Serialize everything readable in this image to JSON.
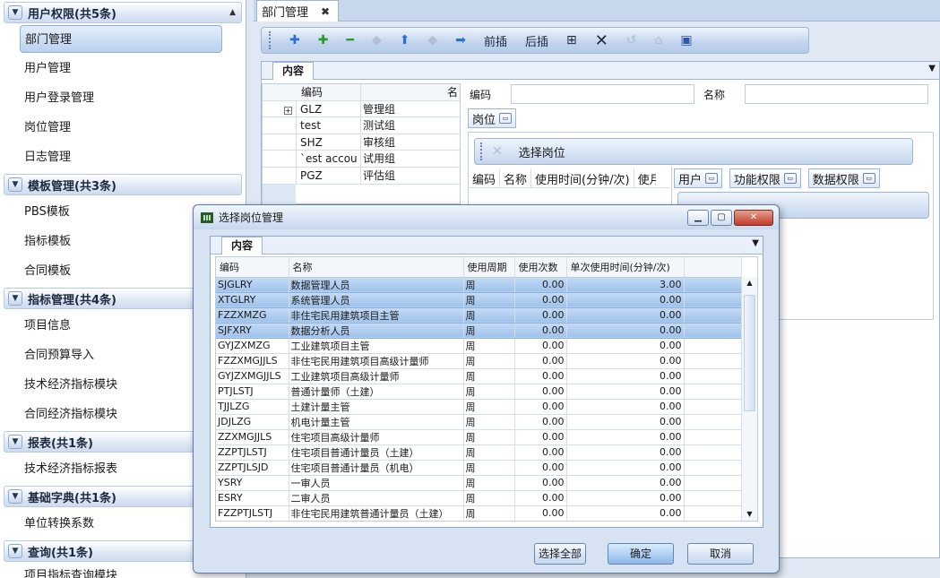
{
  "nav": {
    "groups": [
      {
        "title": "用户权限(共5条)",
        "items": [
          "部门管理",
          "用户管理",
          "用户登录管理",
          "岗位管理",
          "日志管理"
        ]
      },
      {
        "title": "模板管理(共3条)",
        "items": [
          "PBS模板",
          "指标模板",
          "合同模板"
        ]
      },
      {
        "title": "指标管理(共4条)",
        "items": [
          "项目信息",
          "合同预算导入",
          "技术经济指标模块",
          "合同经济指标模块"
        ]
      },
      {
        "title": "报表(共1条)",
        "items": [
          "技术经济指标报表"
        ]
      },
      {
        "title": "基础字典(共1条)",
        "items": [
          "单位转换系数"
        ]
      },
      {
        "title": "查询(共1条)",
        "items": [
          "项目指标查询模块"
        ]
      }
    ],
    "selected": "部门管理"
  },
  "main": {
    "tab_label": "部门管理",
    "toolbar": {
      "insert_before": "前插",
      "insert_after": "后插"
    },
    "content_tab": "内容",
    "dept_grid": {
      "headers": [
        "编码",
        "名"
      ],
      "rows": [
        {
          "code": "GLZ",
          "name": "管理组"
        },
        {
          "code": "test",
          "name": "测试组"
        },
        {
          "code": "SHZ",
          "name": "审核组"
        },
        {
          "code": "`est accou",
          "name": "试用组"
        },
        {
          "code": "PGZ",
          "name": "评估组"
        }
      ]
    },
    "form": {
      "code_label": "编码",
      "name_label": "名称"
    },
    "post_tab": "岗位",
    "select_post_btn": "选择岗位",
    "post_grid_headers": [
      "编码",
      "名称",
      "使用时间(分钟/次)",
      "使月"
    ],
    "sub_tabs": [
      "用户",
      "功能权限",
      "数据权限"
    ]
  },
  "dialog": {
    "title": "选择岗位管理",
    "content_tab": "内容",
    "headers": [
      "编码",
      "名称",
      "使用周期",
      "使用次数",
      "单次使用时间(分钟/次)"
    ],
    "rows": [
      {
        "code": "SJGLRY",
        "name": "数据管理人员",
        "period": "周",
        "count": "0.00",
        "time": "3.00",
        "sel": true
      },
      {
        "code": "XTGLRY",
        "name": "系统管理人员",
        "period": "周",
        "count": "0.00",
        "time": "0.00",
        "sel": true
      },
      {
        "code": "FZZXMZG",
        "name": "非住宅民用建筑项目主管",
        "period": "周",
        "count": "0.00",
        "time": "0.00",
        "sel": true
      },
      {
        "code": "SJFXRY",
        "name": "数据分析人员",
        "period": "周",
        "count": "0.00",
        "time": "0.00",
        "sel": true
      },
      {
        "code": "GYJZXMZG",
        "name": "工业建筑项目主管",
        "period": "周",
        "count": "0.00",
        "time": "0.00",
        "sel": false
      },
      {
        "code": "FZZXMGJJLS",
        "name": "非住宅民用建筑项目高级计量师",
        "period": "周",
        "count": "0.00",
        "time": "0.00",
        "sel": false
      },
      {
        "code": "GYJZXMGJJLS",
        "name": "工业建筑项目高级计量师",
        "period": "周",
        "count": "0.00",
        "time": "0.00",
        "sel": false
      },
      {
        "code": "PTJLSTJ",
        "name": "普通计量师（土建）",
        "period": "周",
        "count": "0.00",
        "time": "0.00",
        "sel": false
      },
      {
        "code": "TJJLZG",
        "name": "土建计量主管",
        "period": "周",
        "count": "0.00",
        "time": "0.00",
        "sel": false
      },
      {
        "code": "JDJLZG",
        "name": "机电计量主管",
        "period": "周",
        "count": "0.00",
        "time": "0.00",
        "sel": false
      },
      {
        "code": "ZZXMGJJLS",
        "name": "住宅项目高级计量师",
        "period": "周",
        "count": "0.00",
        "time": "0.00",
        "sel": false
      },
      {
        "code": "ZZPTJLSTJ",
        "name": "住宅项目普通计量员（土建）",
        "period": "周",
        "count": "0.00",
        "time": "0.00",
        "sel": false
      },
      {
        "code": "ZZPTJLSJD",
        "name": "住宅项目普通计量员（机电）",
        "period": "周",
        "count": "0.00",
        "time": "0.00",
        "sel": false
      },
      {
        "code": "YSRY",
        "name": "一审人员",
        "period": "周",
        "count": "0.00",
        "time": "0.00",
        "sel": false
      },
      {
        "code": "ESRY",
        "name": "二审人员",
        "period": "周",
        "count": "0.00",
        "time": "0.00",
        "sel": false
      },
      {
        "code": "FZZPTJLSTJ",
        "name": "非住宅民用建筑普通计量员（土建）",
        "period": "周",
        "count": "0.00",
        "time": "0.00",
        "sel": false
      }
    ],
    "buttons": {
      "select_all": "选择全部",
      "ok": "确定",
      "cancel": "取消"
    }
  }
}
